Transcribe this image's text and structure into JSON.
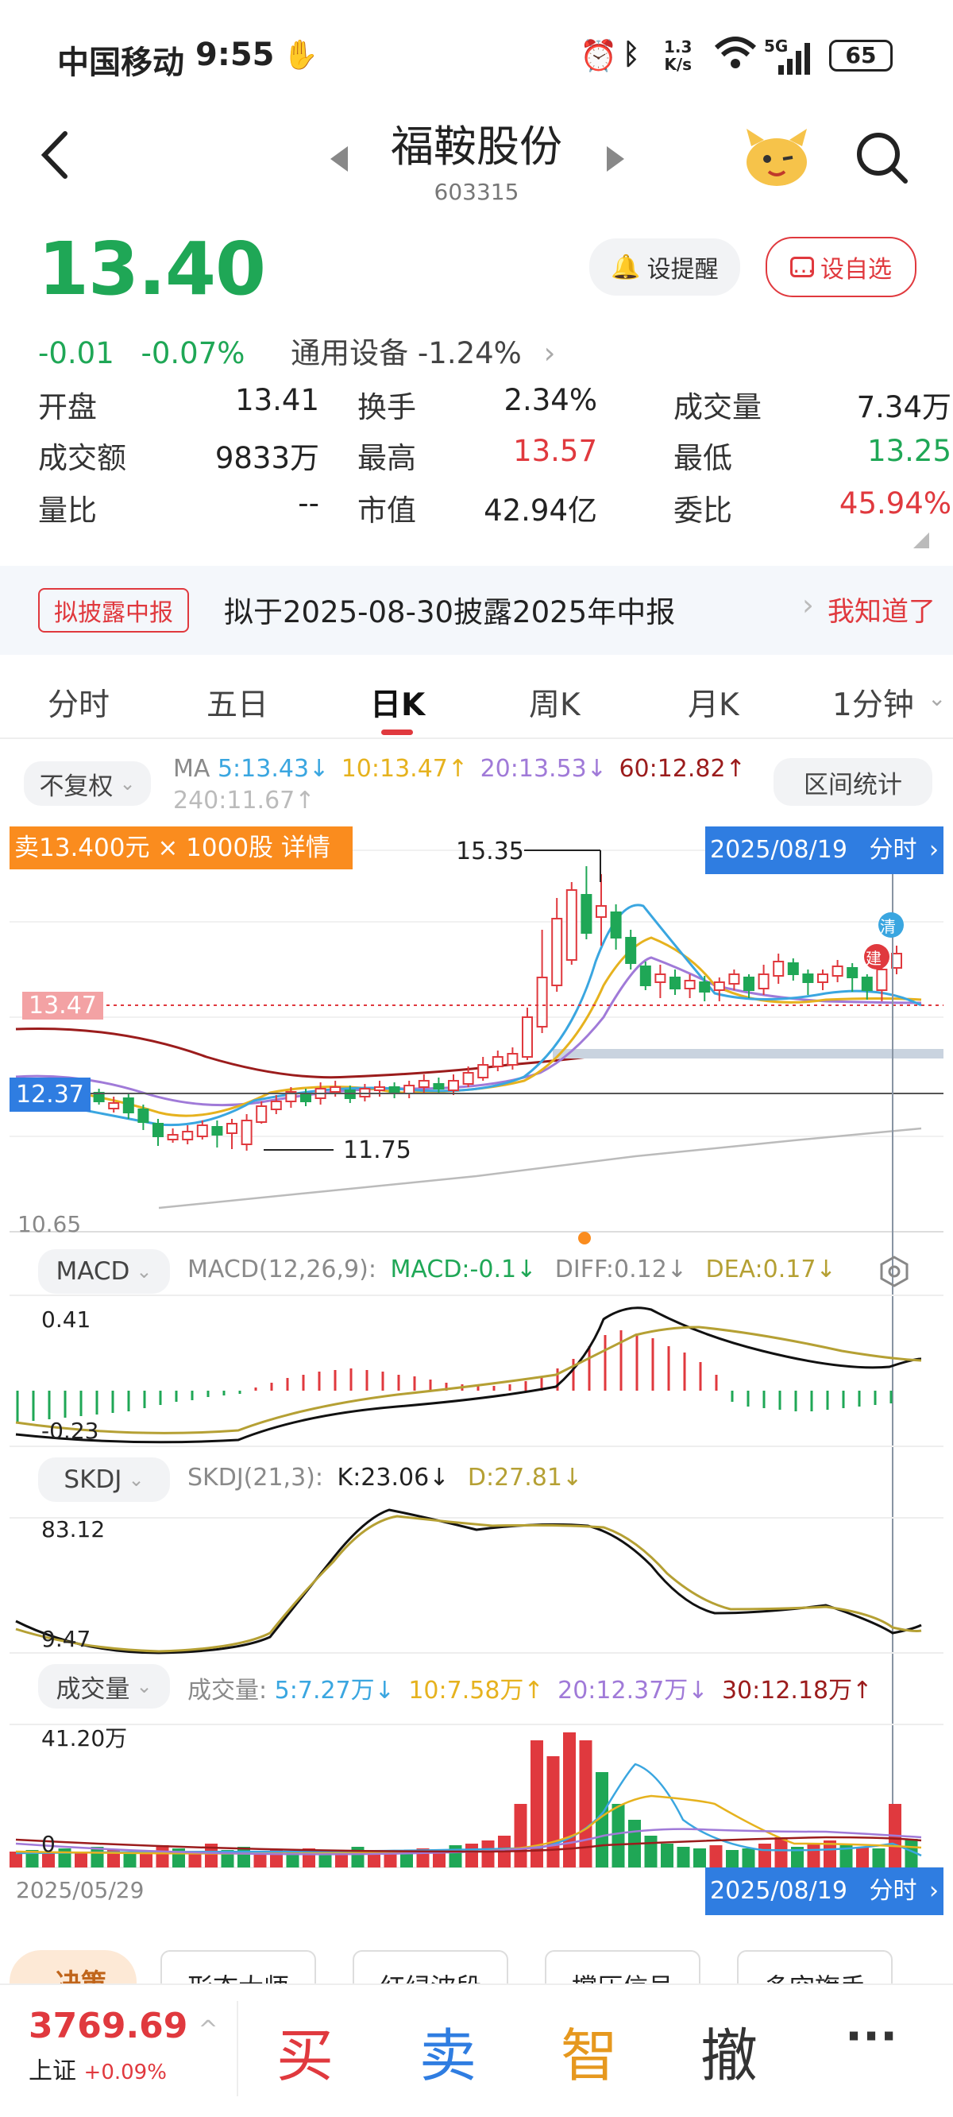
{
  "status": {
    "carrier": "中国移动",
    "time": "9:55",
    "net_speed_top": "1.3",
    "net_speed_bottom": "K/s",
    "signal": "5G",
    "battery": "65"
  },
  "header": {
    "title": "福鞍股份",
    "code": "603315"
  },
  "quote": {
    "price": "13.40",
    "change": "-0.01",
    "change_pct": "-0.07%",
    "sector": "通用设备 -1.24%",
    "alert_label": "设提醒",
    "watch_label": "设自选",
    "stats": [
      {
        "label": "开盘",
        "value": "13.41",
        "color": "#222222"
      },
      {
        "label": "换手",
        "value": "2.34%",
        "color": "#222222"
      },
      {
        "label": "成交量",
        "value": "7.34万",
        "color": "#222222"
      },
      {
        "label": "成交额",
        "value": "9833万",
        "color": "#222222"
      },
      {
        "label": "最高",
        "value": "13.57",
        "color": "#e0393e"
      },
      {
        "label": "最低",
        "value": "13.25",
        "color": "#1fa756"
      },
      {
        "label": "量比",
        "value": "--",
        "color": "#222222"
      },
      {
        "label": "市值",
        "value": "42.94亿",
        "color": "#222222"
      },
      {
        "label": "委比",
        "value": "45.94%",
        "color": "#e0393e"
      }
    ]
  },
  "banner": {
    "tag": "拟披露中报",
    "text": "拟于2025-08-30披露2025年中报",
    "action": "我知道了"
  },
  "tabs": [
    "分时",
    "五日",
    "日K",
    "周K",
    "月K",
    "1分钟"
  ],
  "active_tab": "日K",
  "ma_bar": {
    "adjust_label": "不复权",
    "ma_prefix": "MA",
    "ma5": "5:13.43↓",
    "ma10": "10:13.47↑",
    "ma20": "20:13.53↓",
    "ma60": "60:12.82↑",
    "ma240": "240:11.67↑",
    "range_stat": "区间统计"
  },
  "kline": {
    "sell_tip": "卖13.400元 × 1000股 详情",
    "date_tag": "2025/08/19",
    "date_tag_action": "分时",
    "high_label": "15.35",
    "low_label": "11.75",
    "axis_top_price": "13.47",
    "cross_price": "12.37",
    "axis_bottom": "10.65",
    "marker_clear": "清",
    "marker_build": "建"
  },
  "macd": {
    "btn": "MACD",
    "params": "MACD(12,26,9):",
    "macd": "MACD:-0.1↓",
    "diff": "DIFF:0.12↓",
    "dea": "DEA:0.17↓",
    "top": "0.41",
    "bottom": "-0.23"
  },
  "skdj": {
    "btn": "SKDJ",
    "params": "SKDJ(21,3):",
    "k": "K:23.06↓",
    "d": "D:27.81↓",
    "top": "83.12",
    "bottom": "9.47"
  },
  "volume": {
    "btn": "成交量",
    "prefix": "成交量:",
    "v5": "5:7.27万↓",
    "v10": "10:7.58万↑",
    "v20": "20:12.37万↓",
    "v30": "30:12.18万↑",
    "top": "41.20万",
    "zero": "0",
    "start_date": "2025/05/29",
    "end_date": "2025/08/19",
    "end_action": "分时"
  },
  "strategies": {
    "tag": "决策",
    "items": [
      "形态大师",
      "红绿波段",
      "撑压信号",
      "多空旗手"
    ]
  },
  "bottom": {
    "index_value": "3769.69",
    "index_name": "上证",
    "index_change": "+0.09%",
    "buy": "买",
    "sell": "卖",
    "smart": "智",
    "cancel": "撤",
    "more": "···"
  },
  "colors": {
    "up": "#e0393e",
    "down": "#1fa756",
    "ma5": "#3aa6e0",
    "ma10": "#e6b21e",
    "ma20": "#a07ad8",
    "ma60": "#9b1c1c",
    "ma240": "#bbbbbb",
    "tag_blue": "#2f7de1",
    "tip_orange": "#fa8c1e"
  }
}
